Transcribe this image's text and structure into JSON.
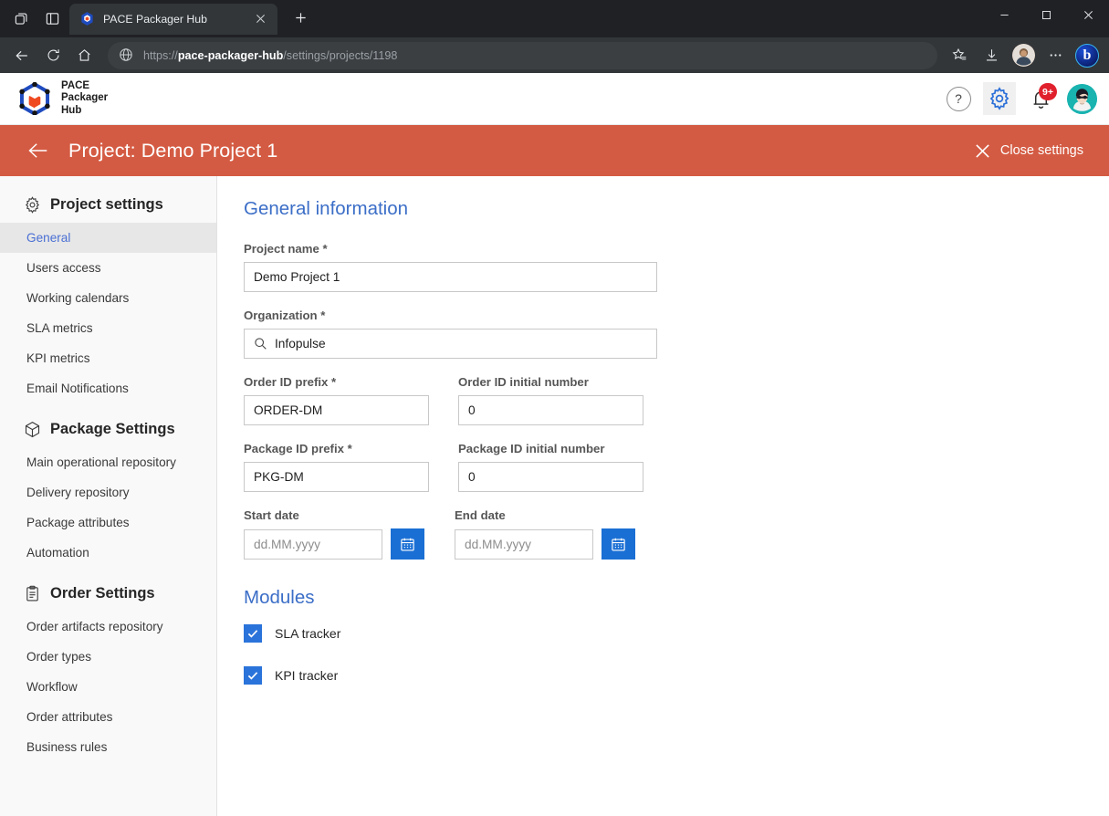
{
  "browser": {
    "tab": {
      "title": "PACE Packager Hub",
      "favicon_icon": "pace-cube-icon",
      "close_icon": "close-icon"
    },
    "newtab_icon": "plus-icon",
    "tab_actions_icon": "tab-search-icon",
    "collections_icon": "collections-icon",
    "window_controls": {
      "minimize": "minimize-icon",
      "maximize": "maximize-icon",
      "close": "close-icon"
    },
    "nav": {
      "back_icon": "back-arrow-icon",
      "refresh_icon": "refresh-icon",
      "home_icon": "home-icon"
    },
    "omnibox": {
      "globe_icon": "globe-icon",
      "scheme": "https://",
      "host": "pace-packager-hub",
      "path": "/settings/projects/1198",
      "full_url": "https://pace-packager-hub/settings/projects/1198"
    },
    "toolbar_right": {
      "favorites_icon": "favorites-star-icon",
      "downloads_icon": "downloads-icon",
      "profile_icon": "profile-avatar-icon",
      "more_icon": "more-ellipsis-icon",
      "copilot_icon": "bing-copilot-icon",
      "copilot_glyph": "b"
    }
  },
  "app_header": {
    "logo_icon": "pace-cube-logo",
    "logo_line1": "PACE",
    "logo_line2": "Packager",
    "logo_line3": "Hub",
    "help_icon": "help-question-icon",
    "help_glyph": "?",
    "settings_icon": "gear-icon",
    "notifications_icon": "bell-icon",
    "notifications_badge": "9+",
    "avatar_icon": "user-avatar"
  },
  "project_bar": {
    "back_icon": "back-arrow-icon",
    "title": "Project: Demo Project 1",
    "close_icon": "close-x-icon",
    "close_label": "Close settings",
    "bg_color": "#d45b43"
  },
  "sidebar": {
    "groups": [
      {
        "label": "Project settings",
        "icon": "gear-icon",
        "items": [
          {
            "label": "General",
            "selected": true
          },
          {
            "label": "Users access",
            "selected": false
          },
          {
            "label": "Working calendars",
            "selected": false
          },
          {
            "label": "SLA metrics",
            "selected": false
          },
          {
            "label": "KPI metrics",
            "selected": false
          },
          {
            "label": "Email Notifications",
            "selected": false
          }
        ]
      },
      {
        "label": "Package Settings",
        "icon": "package-cube-icon",
        "items": [
          {
            "label": "Main operational repository",
            "selected": false
          },
          {
            "label": "Delivery repository",
            "selected": false
          },
          {
            "label": "Package attributes",
            "selected": false
          },
          {
            "label": "Automation",
            "selected": false
          }
        ]
      },
      {
        "label": "Order Settings",
        "icon": "clipboard-icon",
        "items": [
          {
            "label": "Order artifacts repository",
            "selected": false
          },
          {
            "label": "Order types",
            "selected": false
          },
          {
            "label": "Workflow",
            "selected": false
          },
          {
            "label": "Order attributes",
            "selected": false
          },
          {
            "label": "Business rules",
            "selected": false
          }
        ]
      }
    ],
    "selected_color": "#4a6fd4"
  },
  "main": {
    "general_heading": "General information",
    "modules_heading": "Modules",
    "fields": {
      "project_name": {
        "label": "Project name *",
        "value": "Demo Project 1"
      },
      "organization": {
        "label": "Organization *",
        "value": "Infopulse",
        "icon": "search-icon"
      },
      "order_id_prefix": {
        "label": "Order ID prefix *",
        "value": "ORDER-DM"
      },
      "order_id_initial": {
        "label": "Order ID initial number",
        "value": "0"
      },
      "package_id_prefix": {
        "label": "Package ID prefix *",
        "value": "PKG-DM"
      },
      "package_id_initial": {
        "label": "Package ID initial number",
        "value": "0"
      },
      "start_date": {
        "label": "Start date",
        "value": "",
        "placeholder": "dd.MM.yyyy",
        "button_icon": "calendar-icon"
      },
      "end_date": {
        "label": "End date",
        "value": "",
        "placeholder": "dd.MM.yyyy",
        "button_icon": "calendar-icon"
      }
    },
    "modules": [
      {
        "label": "SLA tracker",
        "checked": true
      },
      {
        "label": "KPI tracker",
        "checked": true
      }
    ],
    "heading_color": "#3b6ec7",
    "accent_color": "#1a6fd4"
  }
}
